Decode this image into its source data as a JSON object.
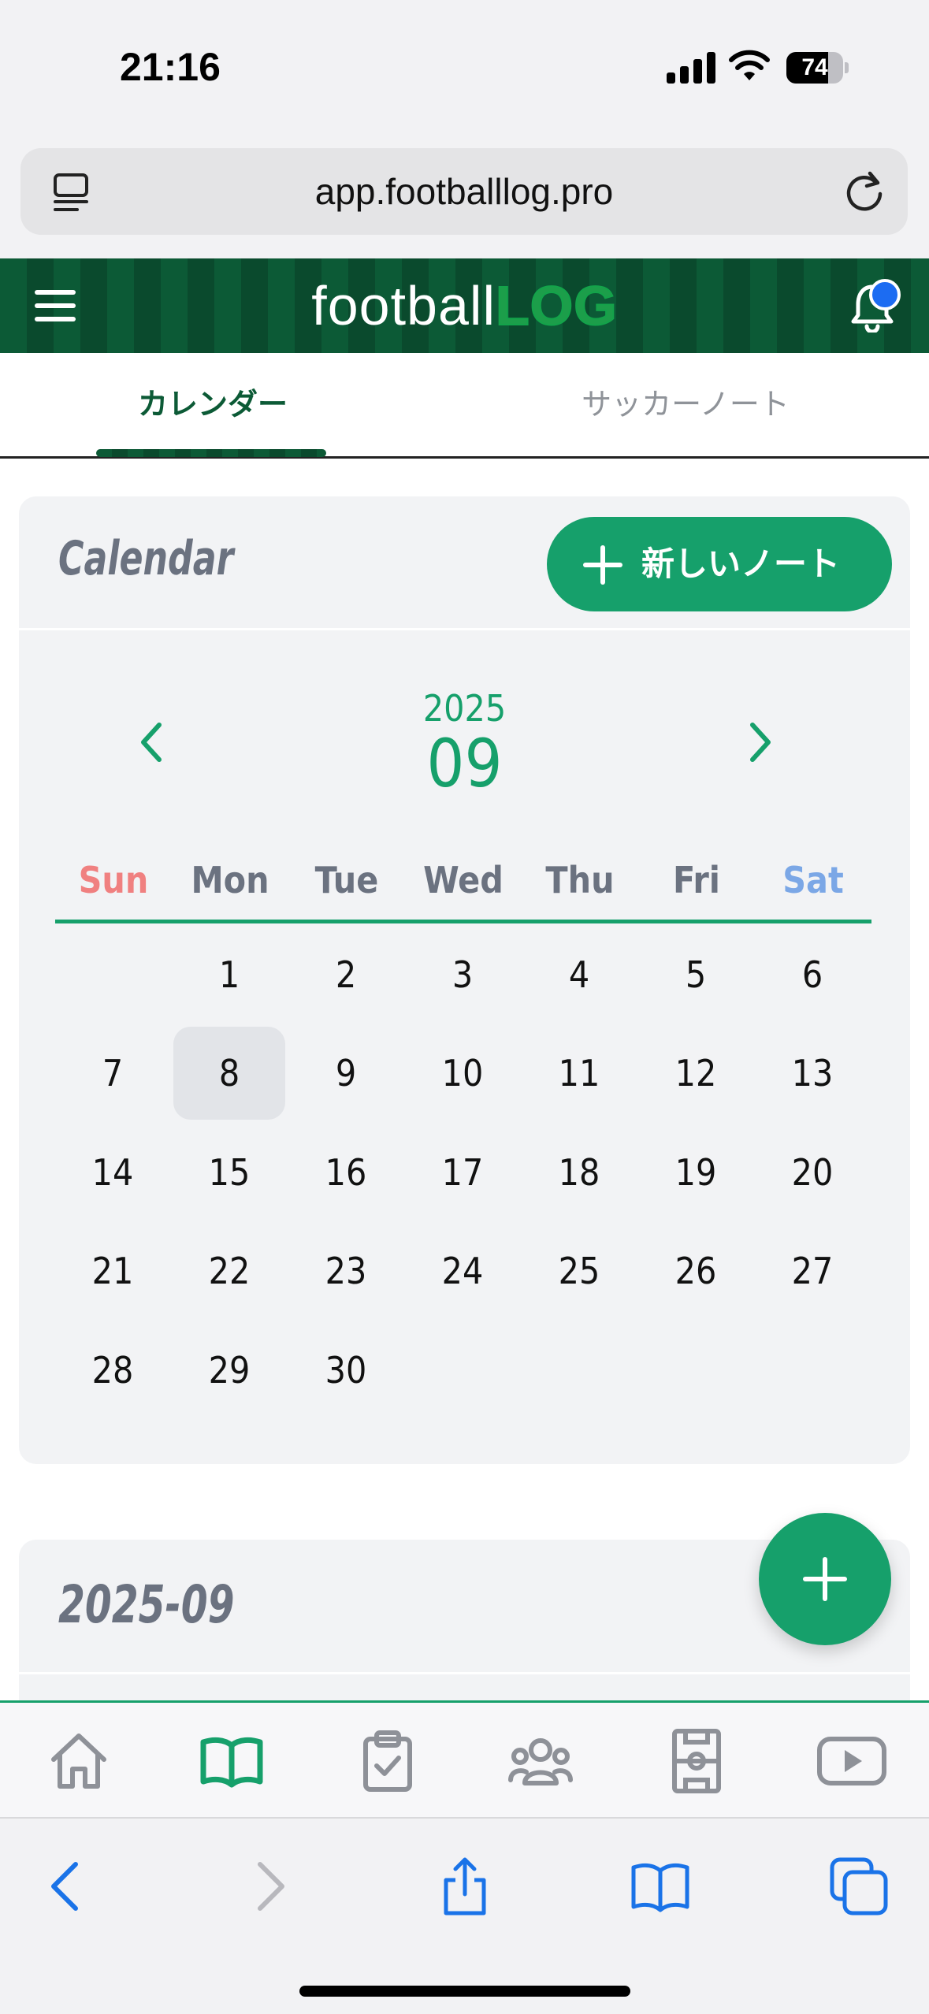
{
  "status_bar": {
    "time": "21:16",
    "battery": "74",
    "battery_level": 0.74
  },
  "browser": {
    "url": "app.footballlog.pro"
  },
  "header": {
    "logo_part1": "football",
    "logo_part2": "LOG",
    "notification_dot": true
  },
  "tabs": [
    {
      "label": "カレンダー",
      "active": true
    },
    {
      "label": "サッカーノート",
      "active": false
    }
  ],
  "calendar": {
    "title": "Calendar",
    "new_note_label": "新しいノート",
    "year": "2025",
    "month": "09",
    "weekdays": [
      "Sun",
      "Mon",
      "Tue",
      "Wed",
      "Thu",
      "Fri",
      "Sat"
    ],
    "weekday_colors": {
      "sun": "#f08080",
      "sat": "#7ba7e6",
      "default": "#6b7280"
    },
    "weeks": [
      [
        "",
        "1",
        "2",
        "3",
        "4",
        "5",
        "6"
      ],
      [
        "7",
        "8",
        "9",
        "10",
        "11",
        "12",
        "13"
      ],
      [
        "14",
        "15",
        "16",
        "17",
        "18",
        "19",
        "20"
      ],
      [
        "21",
        "22",
        "23",
        "24",
        "25",
        "26",
        "27"
      ],
      [
        "28",
        "29",
        "30",
        "",
        "",
        "",
        ""
      ]
    ],
    "selected_day": "8"
  },
  "list_section": {
    "title": "2025-09"
  },
  "bottom_nav": [
    {
      "icon": "home-icon",
      "active": false
    },
    {
      "icon": "book-icon",
      "active": true
    },
    {
      "icon": "clipboard-check-icon",
      "active": false
    },
    {
      "icon": "team-icon",
      "active": false
    },
    {
      "icon": "pitch-icon",
      "active": false
    },
    {
      "icon": "video-icon",
      "active": false
    }
  ],
  "colors": {
    "accent": "#16a06b",
    "header_green": "#0c5a36",
    "ios_blue": "#1a73e8"
  }
}
